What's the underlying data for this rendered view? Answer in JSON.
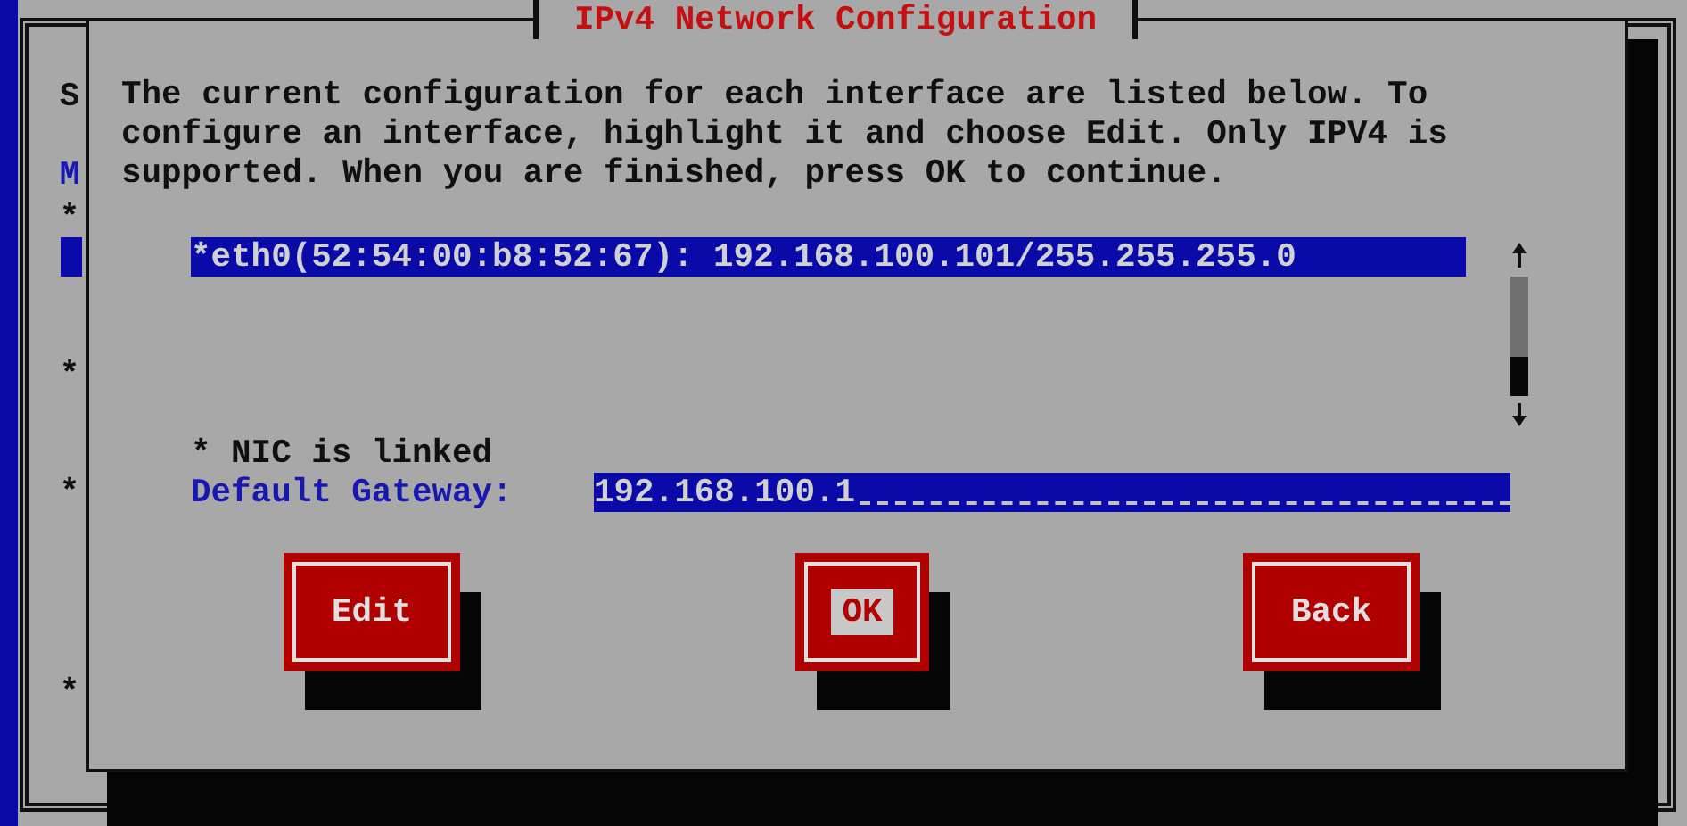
{
  "background_window": {
    "marks": [
      {
        "kind": "text",
        "text": "S"
      },
      {
        "kind": "accent",
        "text": "M"
      },
      {
        "kind": "text",
        "text": "*"
      },
      {
        "kind": "bar"
      },
      {
        "kind": "text",
        "text": "*"
      },
      {
        "kind": "text",
        "text": "*"
      },
      {
        "kind": "text",
        "text": "*"
      }
    ]
  },
  "dialog": {
    "title": "IPv4 Network Configuration",
    "description": "The current configuration for each interface are listed below. To configure an interface, highlight it and choose Edit. Only IPV4 is supported. When you are finished, press OK to continue.",
    "interfaces": [
      {
        "label": "*eth0(52:54:00:b8:52:67): 192.168.100.101/255.255.255.0",
        "selected": true
      }
    ],
    "link_status": "* NIC is linked",
    "gateway": {
      "label": "Default Gateway:",
      "value": "192.168.100.1"
    },
    "buttons": [
      {
        "label": "Edit",
        "selected": false
      },
      {
        "label": "OK",
        "selected": true
      },
      {
        "label": "Back",
        "selected": false
      }
    ]
  }
}
